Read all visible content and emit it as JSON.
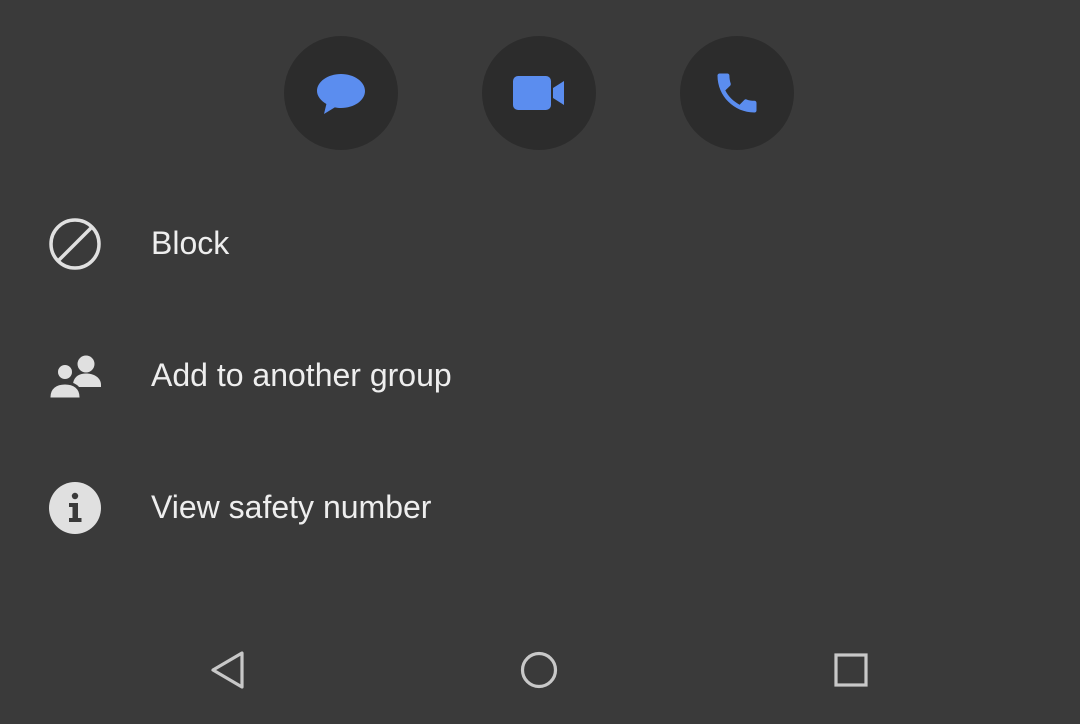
{
  "actions": [
    {
      "name": "message",
      "icon": "chat-bubble-icon"
    },
    {
      "name": "video-call",
      "icon": "video-camera-icon"
    },
    {
      "name": "voice-call",
      "icon": "phone-icon"
    }
  ],
  "menu": {
    "block": {
      "label": "Block",
      "icon": "block-icon"
    },
    "add_group": {
      "label": "Add to another group",
      "icon": "group-icon"
    },
    "safety": {
      "label": "View safety number",
      "icon": "info-icon"
    }
  },
  "navbar": {
    "back_icon": "back-triangle-icon",
    "home_icon": "home-circle-icon",
    "recents_icon": "recents-square-icon"
  },
  "colors": {
    "background": "#3a3a3a",
    "button_bg": "#2c2c2c",
    "accent": "#5b8def",
    "text": "#eeeeee",
    "icon": "#e0e0e0"
  }
}
